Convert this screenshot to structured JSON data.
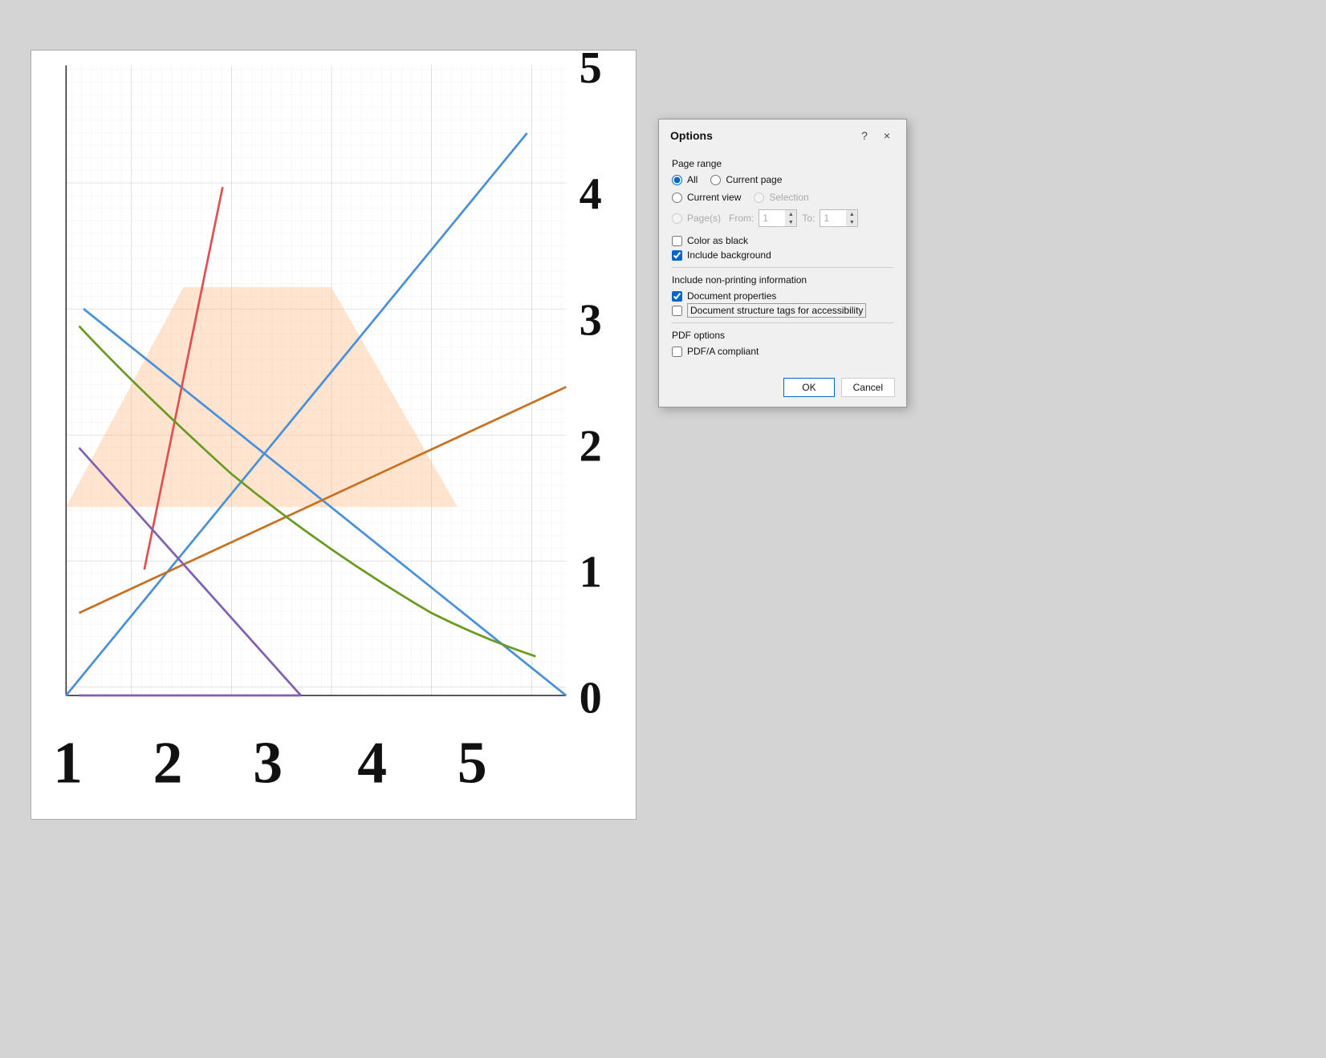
{
  "background_color": "#d4d4d4",
  "graph": {
    "y_labels": [
      "5",
      "4",
      "3",
      "2",
      "1",
      "0"
    ],
    "x_labels": [
      "1",
      "2",
      "3",
      "4",
      "5"
    ]
  },
  "dialog": {
    "title": "Options",
    "help_label": "?",
    "close_label": "×",
    "section_page_range": "Page range",
    "radio_all": "All",
    "radio_current_page": "Current page",
    "radio_current_view": "Current view",
    "radio_selection": "Selection",
    "radio_pages": "Page(s)",
    "from_label": "From:",
    "from_value": "1",
    "to_label": "To:",
    "to_value": "1",
    "checkbox_color_as_black": "Color as black",
    "checkbox_include_background": "Include background",
    "section_non_printing": "Include non-printing information",
    "checkbox_document_properties": "Document properties",
    "checkbox_doc_structure": "Document structure tags for accessibility",
    "section_pdf_options": "PDF options",
    "checkbox_pdf_a": "PDF/A compliant",
    "btn_ok": "OK",
    "btn_cancel": "Cancel"
  }
}
